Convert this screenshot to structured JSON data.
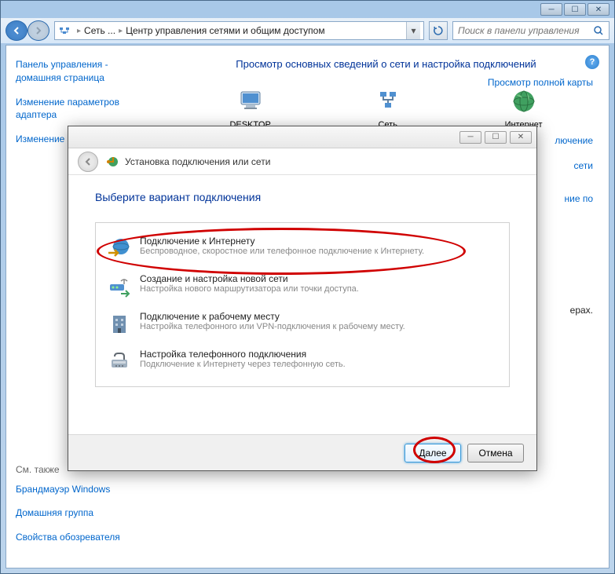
{
  "window": {
    "breadcrumb_root": "Сеть ...",
    "breadcrumb_current": "Центр управления сетями и общим доступом",
    "search_placeholder": "Поиск в панели управления"
  },
  "sidebar": {
    "links": [
      "Панель управления - домашняя страница",
      "Изменение параметров адаптера",
      "Изменение параметров"
    ],
    "bottom_header": "См. также",
    "bottom_links": [
      "Брандмауэр Windows",
      "Домашняя группа",
      "Свойства обозревателя"
    ]
  },
  "main": {
    "heading": "Просмотр основных сведений о сети и настройка подключений",
    "nodes": {
      "desktop": "DESKTOP",
      "network": "Сеть",
      "internet": "Интернет"
    },
    "right_links": {
      "map": "Просмотр полной карты",
      "connection": "лючение",
      "by": "ние по",
      "network": "сети",
      "params": "ерах."
    }
  },
  "wizard": {
    "title": "Установка подключения или сети",
    "heading": "Выберите вариант подключения",
    "options": [
      {
        "title": "Подключение к Интернету",
        "desc": "Беспроводное, скоростное или телефонное подключение к Интернету."
      },
      {
        "title": "Создание и настройка новой сети",
        "desc": "Настройка нового маршрутизатора или точки доступа."
      },
      {
        "title": "Подключение к рабочему месту",
        "desc": "Настройка телефонного или VPN-подключения к рабочему месту."
      },
      {
        "title": "Настройка телефонного подключения",
        "desc": "Подключение к Интернету через телефонную сеть."
      }
    ],
    "next_label": "Далее",
    "cancel_label": "Отмена"
  }
}
